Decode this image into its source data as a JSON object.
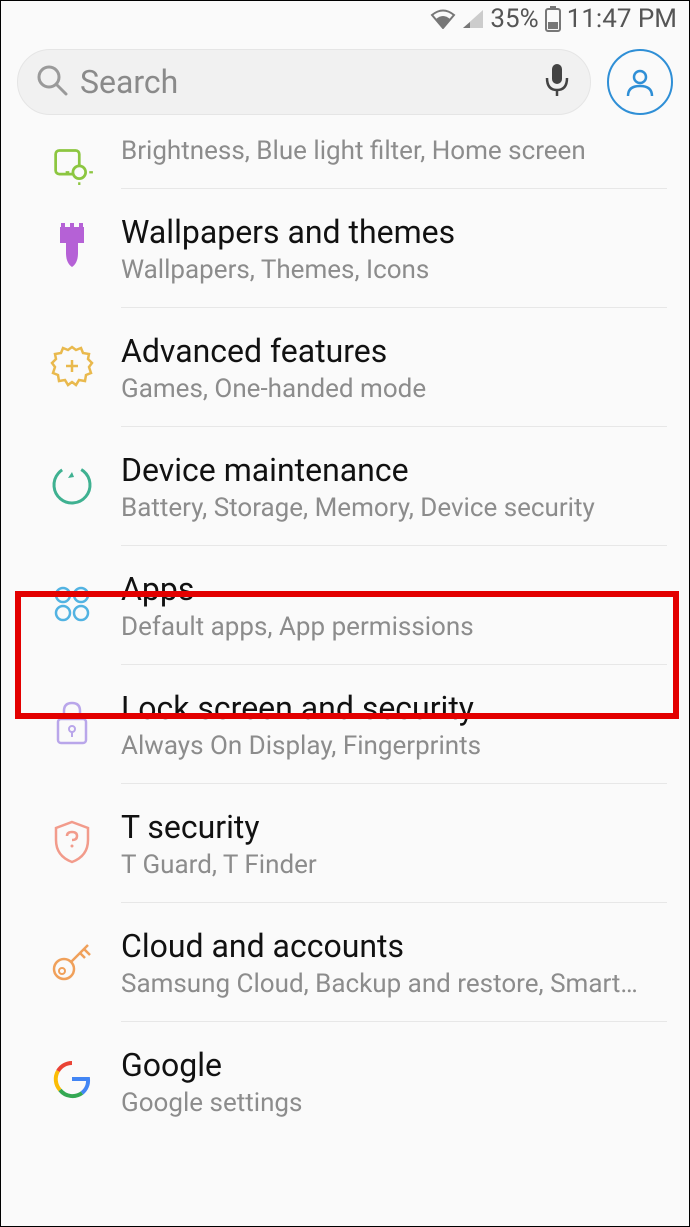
{
  "status": {
    "battery": "35%",
    "time": "11:47 PM"
  },
  "search": {
    "placeholder": "Search"
  },
  "partial": {
    "sub": "Brightness, Blue light filter, Home screen"
  },
  "items": [
    {
      "title": "Wallpapers and themes",
      "sub": "Wallpapers, Themes, Icons"
    },
    {
      "title": "Advanced features",
      "sub": "Games, One-handed mode"
    },
    {
      "title": "Device maintenance",
      "sub": "Battery, Storage, Memory, Device security"
    },
    {
      "title": "Apps",
      "sub": "Default apps, App permissions"
    },
    {
      "title": "Lock screen and security",
      "sub": "Always On Display, Fingerprints"
    },
    {
      "title": "T security",
      "sub": "T Guard, T Finder"
    },
    {
      "title": "Cloud and accounts",
      "sub": "Samsung Cloud, Backup and restore, Smart…"
    },
    {
      "title": "Google",
      "sub": "Google settings"
    }
  ]
}
